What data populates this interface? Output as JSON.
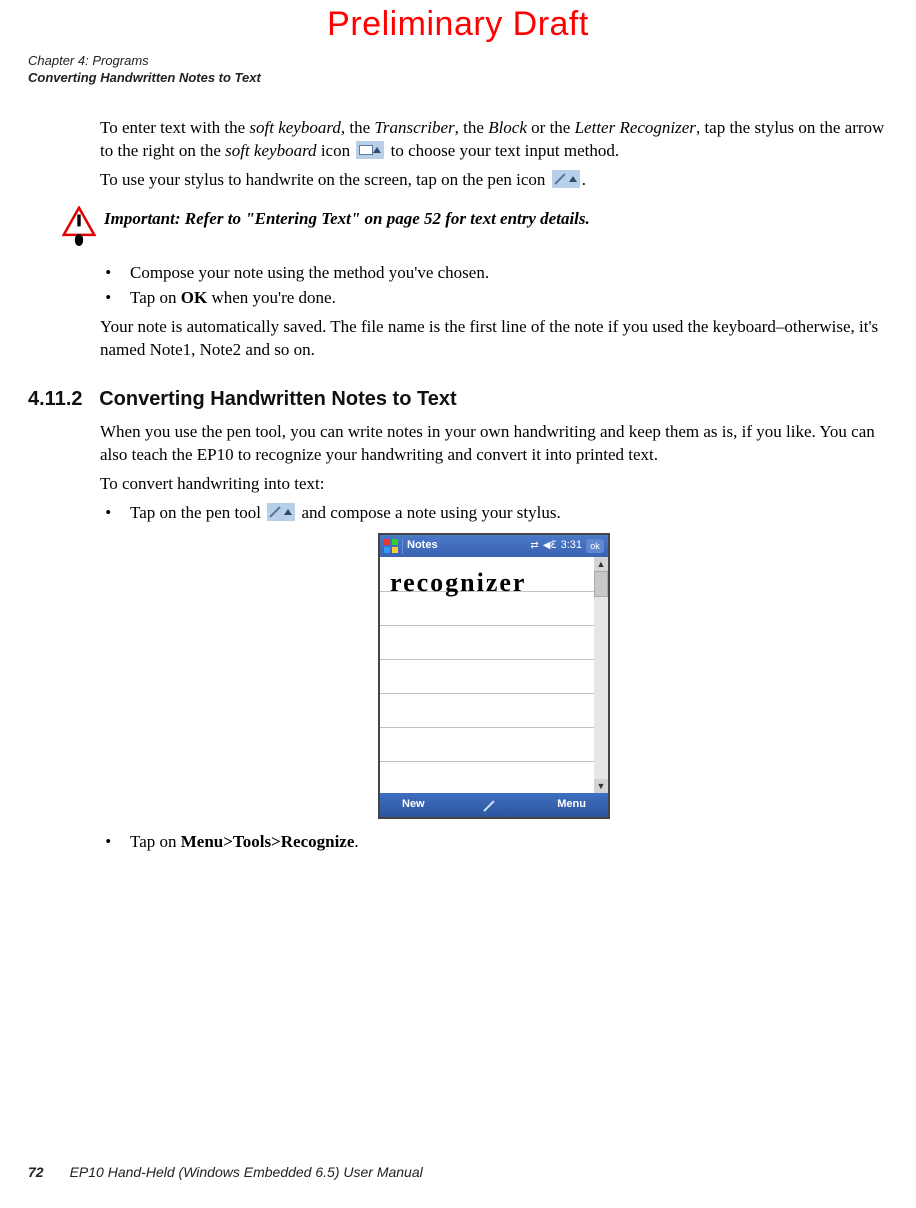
{
  "watermark": "Preliminary Draft",
  "running_head_line1": "Chapter 4: Programs",
  "running_head_line2": "Converting Handwritten Notes to Text",
  "p1_a": "To enter text with the ",
  "p1_soft": "soft keyboard",
  "p1_b": ", the ",
  "p1_trans": "Transcriber",
  "p1_c": ", the ",
  "p1_block": "Block",
  "p1_d": " or the ",
  "p1_letter": "Letter Recognizer",
  "p1_e": ", tap the stylus on the arrow to the right on the ",
  "p1_soft2": "soft keyboard",
  "p1_f": " icon ",
  "p1_g": " to choose your text input method.",
  "p2_a": "To use your stylus to handwrite on the screen, tap on the pen icon ",
  "p2_b": ".",
  "important_label": "Important:  Refer to \"Entering Text\" on page 52 for text entry details.",
  "li1": "Compose your note using the method you've chosen.",
  "li2_a": "Tap on ",
  "li2_b": "OK",
  "li2_c": " when you're done.",
  "p3": "Your note is automatically saved. The file name is the first line of the note if you used the keyboard–otherwise, it's named Note1, Note2 and so on.",
  "section_no": "4.11.2",
  "section_title": "Converting Handwritten Notes to Text",
  "p4": "When you use the pen tool, you can write notes in your own handwriting and keep them as is, if you like. You can also teach the EP10 to recognize your handwriting and convert it into printed text.",
  "p5": "To convert handwriting into text:",
  "li3_a": "Tap on the pen tool ",
  "li3_b": " and compose a note using your stylus.",
  "li4_a": "Tap on ",
  "li4_b": "Menu>Tools>Recognize",
  "li4_c": ".",
  "device": {
    "app_title": "Notes",
    "time": "3:31",
    "ok": "ok",
    "handwriting": "recognizer",
    "soft_left": "New",
    "soft_right": "Menu"
  },
  "footer": {
    "page": "72",
    "manual": "EP10 Hand-Held (Windows Embedded 6.5) User Manual"
  }
}
